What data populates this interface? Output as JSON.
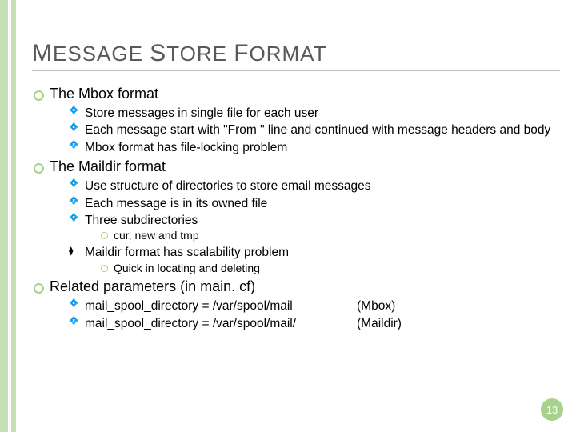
{
  "title_parts": {
    "w1a": "M",
    "w1b": "ESSAGE",
    "w2a": "S",
    "w2b": "TORE",
    "w3a": "F",
    "w3b": "ORMAT"
  },
  "sections": {
    "mbox": {
      "heading": "The Mbox format",
      "items": [
        "Store messages in single file for each user",
        "Each message start with \"From \" line and continued with message headers and body",
        "Mbox format has file-locking problem"
      ]
    },
    "maildir": {
      "heading": "The Maildir format",
      "items_a": [
        "Use structure of directories to store email messages",
        "Each message is in its owned file",
        "Three subdirectories"
      ],
      "sub_a": "cur, new and tmp",
      "item_b": "Maildir format has scalability problem",
      "sub_b": "Quick in locating and deleting"
    },
    "related": {
      "heading": "Related parameters (in main. cf)",
      "rows": [
        {
          "path": "mail_spool_directory = /var/spool/mail",
          "note": "(Mbox)"
        },
        {
          "path": "mail_spool_directory = /var/spool/mail/",
          "note": "(Maildir)"
        }
      ]
    }
  },
  "page_number": "13"
}
